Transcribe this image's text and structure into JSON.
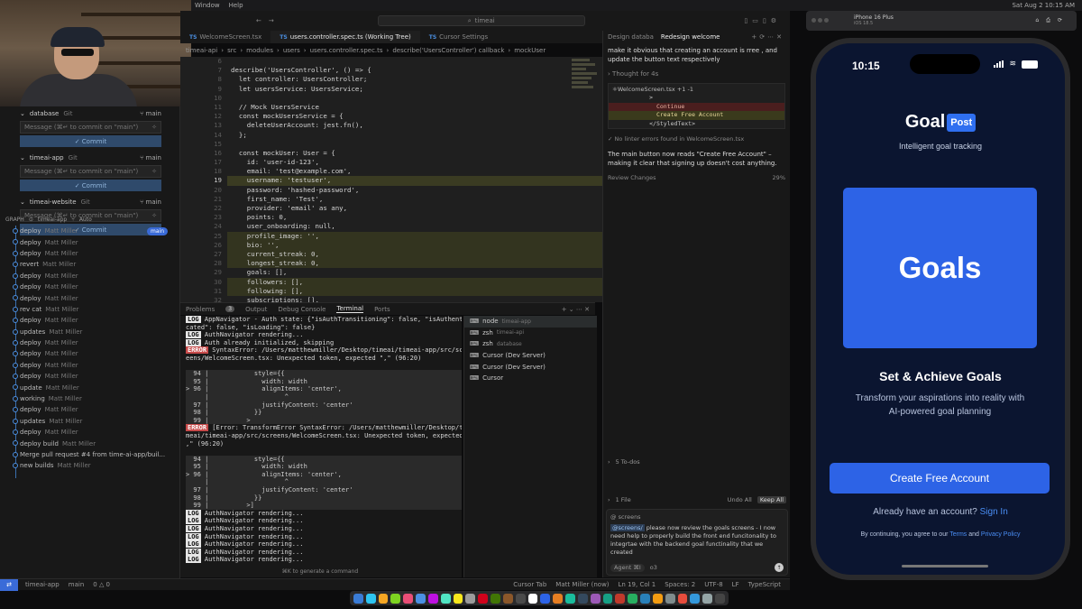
{
  "menubar": {
    "items": [
      "Window",
      "Help"
    ],
    "datetime": "Sat Aug 2 10:15 AM"
  },
  "titlebar": {
    "search": "timeai"
  },
  "tabs": [
    {
      "label": "WelcomeScreen.tsx",
      "active": false
    },
    {
      "label": "users.controller.spec.ts (Working Tree)",
      "active": true
    },
    {
      "label": "Cursor Settings",
      "active": false
    }
  ],
  "breadcrumb": [
    "timeai-api",
    "src",
    "modules",
    "users",
    "users.controller.spec.ts",
    "describe('UsersController') callback",
    "mockUser"
  ],
  "scm": {
    "repos": [
      {
        "name": "database",
        "kind": "Git",
        "branch": "main",
        "placeholder": "Message (⌘↵ to commit on \"main\")",
        "commit": "Commit"
      },
      {
        "name": "timeai-app",
        "kind": "Git",
        "branch": "main",
        "placeholder": "Message (⌘↵ to commit on \"main\")",
        "commit": "Commit"
      },
      {
        "name": "timeai-website",
        "kind": "Git",
        "branch": "main",
        "placeholder": "Message (⌘↵ to commit on \"main\")",
        "commit": "Commit"
      }
    ],
    "graph_header": [
      "GRAPH",
      "timeai-app",
      "Auto"
    ],
    "main_tag": "main",
    "commits": [
      {
        "msg": "deploy",
        "author": "Matt Miller"
      },
      {
        "msg": "deploy",
        "author": "Matt Miller"
      },
      {
        "msg": "deploy",
        "author": "Matt Miller"
      },
      {
        "msg": "revert",
        "author": "Matt Miller"
      },
      {
        "msg": "deploy",
        "author": "Matt Miller"
      },
      {
        "msg": "deploy",
        "author": "Matt Miller"
      },
      {
        "msg": "deploy",
        "author": "Matt Miller"
      },
      {
        "msg": "rev cat",
        "author": "Matt Miller"
      },
      {
        "msg": "deploy",
        "author": "Matt Miller"
      },
      {
        "msg": "updates",
        "author": "Matt Miller"
      },
      {
        "msg": "deploy",
        "author": "Matt Miller"
      },
      {
        "msg": "deploy",
        "author": "Matt Miller"
      },
      {
        "msg": "deploy",
        "author": "Matt Miller"
      },
      {
        "msg": "deploy",
        "author": "Matt Miller"
      },
      {
        "msg": "update",
        "author": "Matt Miller"
      },
      {
        "msg": "working",
        "author": "Matt Miller"
      },
      {
        "msg": "deploy",
        "author": "Matt Miller"
      },
      {
        "msg": "updates",
        "author": "Matt Miller"
      },
      {
        "msg": "deploy",
        "author": "Matt Miller"
      },
      {
        "msg": "deploy build",
        "author": "Matt Miller"
      },
      {
        "msg": "Merge pull request #4 from time-ai-app/buil...",
        "author": ""
      },
      {
        "msg": "new builds",
        "author": "Matt Miller"
      }
    ]
  },
  "code": {
    "lines": [
      {
        "n": "6",
        "t": "",
        "h": ""
      },
      {
        "n": "7",
        "t": "describe('UsersController', () => {",
        "h": ""
      },
      {
        "n": "8",
        "t": "  let controller: UsersController;",
        "h": ""
      },
      {
        "n": "9",
        "t": "  let usersService: UsersService;",
        "h": ""
      },
      {
        "n": "10",
        "t": "",
        "h": ""
      },
      {
        "n": "11",
        "t": "  // Mock UsersService",
        "h": ""
      },
      {
        "n": "12",
        "t": "  const mockUsersService = {",
        "h": ""
      },
      {
        "n": "13",
        "t": "    deleteUserAccount: jest.fn(),",
        "h": ""
      },
      {
        "n": "14",
        "t": "  };",
        "h": ""
      },
      {
        "n": "15",
        "t": "",
        "h": ""
      },
      {
        "n": "16",
        "t": "  const mockUser: User = {",
        "h": ""
      },
      {
        "n": "17",
        "t": "    id: 'user-id-123',",
        "h": ""
      },
      {
        "n": "18",
        "t": "    email: 'test@example.com',",
        "h": ""
      },
      {
        "n": "19",
        "t": "    username: 'testuser',",
        "h": "hl"
      },
      {
        "n": "20",
        "t": "    password: 'hashed-password',",
        "h": ""
      },
      {
        "n": "21",
        "t": "    first_name: 'Test',",
        "h": ""
      },
      {
        "n": "22",
        "t": "    provider: 'email' as any,",
        "h": ""
      },
      {
        "n": "23",
        "t": "    points: 0,",
        "h": ""
      },
      {
        "n": "24",
        "t": "    user_onboarding: null,",
        "h": ""
      },
      {
        "n": "25",
        "t": "    profile_image: '',",
        "h": "hl2"
      },
      {
        "n": "26",
        "t": "    bio: '',",
        "h": "hl2"
      },
      {
        "n": "27",
        "t": "    current_streak: 0,",
        "h": "hl2"
      },
      {
        "n": "28",
        "t": "    longest_streak: 0,",
        "h": "hl2"
      },
      {
        "n": "29",
        "t": "    goals: [],",
        "h": ""
      },
      {
        "n": "30",
        "t": "    followers: [],",
        "h": "hl2"
      },
      {
        "n": "31",
        "t": "    following: [],",
        "h": "hl2"
      },
      {
        "n": "32",
        "t": "    subscriptions: [],",
        "h": ""
      }
    ],
    "current_line": "19"
  },
  "panel": {
    "tabs": [
      "Problems",
      "Output",
      "Debug Console",
      "Terminal",
      "Ports"
    ],
    "problems_count": "3",
    "terminal_lines": [
      {
        "tag": "LOG",
        "text": " AppNavigator - Auth state: {\"isAuthTransitioning\": false, \"isAuthenti",
        "box": false
      },
      {
        "tag": "",
        "text": "cated\": false, \"isLoading\": false}",
        "box": false
      },
      {
        "tag": "LOG",
        "text": " AuthNavigator rendering...",
        "box": false
      },
      {
        "tag": "LOG",
        "text": " Auth already initialized, skipping",
        "box": false
      },
      {
        "tag": "ERROR",
        "text": " SyntaxError: /Users/matthewmiller/Desktop/timeai/timeai-app/src/scr",
        "box": false
      },
      {
        "tag": "",
        "text": "eens/WelcomeScreen.tsx: Unexpected token, expected \",\" (96:20)",
        "box": false
      },
      {
        "tag": "",
        "text": "",
        "box": false
      },
      {
        "tag": "",
        "text": "  94 |            style={{",
        "box": true
      },
      {
        "tag": "",
        "text": "  95 |              width: width",
        "box": true
      },
      {
        "tag": "",
        "text": "> 96 |              alignItems: 'center',",
        "box": true
      },
      {
        "tag": "",
        "text": "     |                    ^",
        "box": true
      },
      {
        "tag": "",
        "text": "  97 |              justifyContent: 'center'",
        "box": true
      },
      {
        "tag": "",
        "text": "  98 |            }}",
        "box": true
      },
      {
        "tag": "",
        "text": "  99 |          >",
        "box": true
      },
      {
        "tag": "ERROR",
        "text": " [Error: TransformError SyntaxError: /Users/matthewmiller/Desktop/ti",
        "box": false
      },
      {
        "tag": "",
        "text": "meai/timeai-app/src/screens/WelcomeScreen.tsx: Unexpected token, expected \"",
        "box": false
      },
      {
        "tag": "",
        "text": ",\" (96:20)",
        "box": false
      },
      {
        "tag": "",
        "text": "",
        "box": false
      },
      {
        "tag": "",
        "text": "  94 |            style={{",
        "box": true
      },
      {
        "tag": "",
        "text": "  95 |              width: width",
        "box": true
      },
      {
        "tag": "",
        "text": "> 96 |              alignItems: 'center',",
        "box": true
      },
      {
        "tag": "",
        "text": "     |                    ^",
        "box": true
      },
      {
        "tag": "",
        "text": "  97 |              justifyContent: 'center'",
        "box": true
      },
      {
        "tag": "",
        "text": "  98 |            }}",
        "box": true
      },
      {
        "tag": "",
        "text": "  99 |          >]",
        "box": true
      },
      {
        "tag": "LOG",
        "text": " AuthNavigator rendering...",
        "box": false
      },
      {
        "tag": "LOG",
        "text": " AuthNavigator rendering...",
        "box": false
      },
      {
        "tag": "LOG",
        "text": " AuthNavigator rendering...",
        "box": false
      },
      {
        "tag": "LOG",
        "text": " AuthNavigator rendering...",
        "box": false
      },
      {
        "tag": "LOG",
        "text": " AuthNavigator rendering...",
        "box": false
      },
      {
        "tag": "LOG",
        "text": " AuthNavigator rendering...",
        "box": false
      },
      {
        "tag": "LOG",
        "text": " AuthNavigator rendering...",
        "box": false
      }
    ],
    "hint": "⌘K to generate a command",
    "terminals": [
      {
        "name": "node",
        "sub": "timeai-app",
        "sel": true
      },
      {
        "name": "zsh",
        "sub": "timeai-api",
        "sel": false
      },
      {
        "name": "zsh",
        "sub": "database",
        "sel": false
      },
      {
        "name": "Cursor (Dev Server)",
        "sub": "",
        "sel": false
      },
      {
        "name": "Cursor (Dev Server)",
        "sub": "",
        "sel": false
      },
      {
        "name": "Cursor",
        "sub": "",
        "sel": false
      }
    ]
  },
  "chat": {
    "tabs": [
      "Design databa",
      "Redesign welcome"
    ],
    "request": "make it obvious that creating an account is rree , and update the button text respectively",
    "thought": "Thought for 4s",
    "diff_file": "WelcomeScreen.tsx +1 -1",
    "diff_lines": [
      {
        "t": "          >",
        "k": ""
      },
      {
        "t": "            Continue",
        "k": "del"
      },
      {
        "t": "            Create Free Account",
        "k": "add"
      },
      {
        "t": "          </StyledText>",
        "k": ""
      }
    ],
    "lint": "No linter errors found in WelcomeScreen.tsx",
    "summary": "The main button now reads \"Create Free Account\" – making it clear that signing up doesn't cost anything.",
    "review": "Review Changes",
    "progress": "29%",
    "todos": "5 To-dos",
    "files": "1 File",
    "undo_all": "Undo All",
    "keep_all": "Keep All",
    "context_chip": "screens",
    "input_mention": "@screens/",
    "input_text": " please now review the goals screens - I now need help to properly build the front end funcitonality to integrtae with the backend goal functinality that we created",
    "agent": "Agent",
    "model": "o3"
  },
  "statusbar": {
    "left": [
      "timeai-app",
      "main",
      "0 △ 0"
    ],
    "right": [
      "Cursor Tab",
      "Matt Miller (now)",
      "Ln 19, Col 1",
      "Spaces: 2",
      "UTF-8",
      "LF",
      "TypeScript"
    ]
  },
  "simulator": {
    "device": "iPhone 16 Plus",
    "os": "iOS 18.5",
    "time": "10:15",
    "logo_goal": "Goal",
    "logo_post": "Post",
    "tagline": "Intelligent goal tracking",
    "card_title": "Goals",
    "headline": "Set & Achieve Goals",
    "subtext": "Transform your aspirations into reality with AI-powered goal planning",
    "cta": "Create Free Account",
    "signin_prefix": "Already have an account?",
    "signin_link": "Sign In",
    "legal_prefix": "By continuing, you agree to our",
    "legal_terms": "Terms",
    "legal_and": "and",
    "legal_privacy": "Privacy Policy",
    "accent": "#2d63e6",
    "bg": "#0b1530"
  }
}
